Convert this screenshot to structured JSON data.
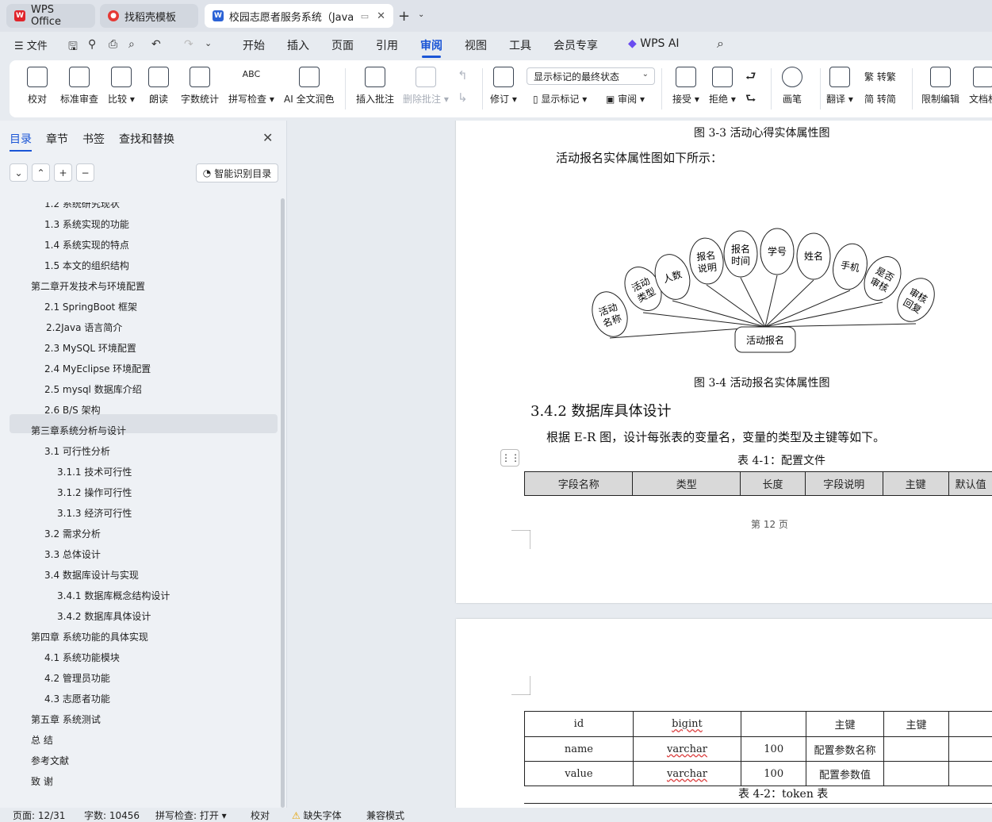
{
  "tabs": [
    {
      "label": "WPS Office",
      "icon": "wps-logo-icon",
      "color": "#e0242b"
    },
    {
      "label": "找稻壳模板",
      "icon": "docer-logo-icon",
      "color": "#e53935"
    },
    {
      "label": "校园志愿者服务系统（Java+s",
      "icon": "word-doc-icon",
      "color": "#2b62d6"
    }
  ],
  "menu": {
    "file": "文件",
    "items": [
      "开始",
      "插入",
      "页面",
      "引用",
      "审阅",
      "视图",
      "工具",
      "会员专享"
    ],
    "active": "审阅",
    "ai": "WPS AI"
  },
  "ribbon": {
    "buttons": [
      {
        "label": "校对"
      },
      {
        "label": "标准审查"
      },
      {
        "label": "比较 ▾"
      },
      {
        "label": "朗读"
      },
      {
        "label": "字数统计"
      },
      {
        "label": "拼写检查 ▾"
      },
      {
        "label": "AI 全文润色"
      },
      {
        "label": "插入批注"
      },
      {
        "label": "删除批注 ▾"
      },
      {
        "label": "修订 ▾"
      },
      {
        "label": "接受 ▾"
      },
      {
        "label": "拒绝 ▾"
      },
      {
        "label": "画笔"
      },
      {
        "label": "翻译 ▾"
      },
      {
        "label": "限制编辑"
      },
      {
        "label": "文档权"
      }
    ],
    "markup_select": "显示标记的最终状态",
    "show_markup": "显示标记 ▾",
    "review": "审阅 ▾",
    "to_traditional": "转繁",
    "to_simplified": "转简"
  },
  "sidebar": {
    "tabs": [
      "目录",
      "章节",
      "书签",
      "查找和替换"
    ],
    "ai_toc": "智能识别目录",
    "toc": [
      {
        "text": "1.2   系统研究现状"
      },
      {
        "text": "1.3   系统实现的功能"
      },
      {
        "text": "1.4 系统实现的特点"
      },
      {
        "text": "1.5   本文的组织结构"
      },
      {
        "text": "第二章开发技术与环境配置"
      },
      {
        "text": "2.1   SpringBoot 框架"
      },
      {
        "text": "2.2Java 语言简介"
      },
      {
        "text": "2.3   MySQL 环境配置"
      },
      {
        "text": "2.4   MyEclipse 环境配置"
      },
      {
        "text": "2.5   mysql 数据库介绍"
      },
      {
        "text": "2.6   B/S 架构"
      },
      {
        "text": "第三章系统分析与设计"
      },
      {
        "text": "3.1  可行性分析"
      },
      {
        "text": "3.1.1  技术可行性"
      },
      {
        "text": "3.1.2  操作可行性"
      },
      {
        "text": "3.1.3 经济可行性"
      },
      {
        "text": "3.2   需求分析"
      },
      {
        "text": "3.3   总体设计"
      },
      {
        "text": "3.4   数据库设计与实现"
      },
      {
        "text": "3.4.1    数据库概念结构设计"
      },
      {
        "text": "3.4.2 数据库具体设计"
      },
      {
        "text": "第四章   系统功能的具体实现"
      },
      {
        "text": "4.1  系统功能模块"
      },
      {
        "text": "4.2 管理员功能"
      },
      {
        "text": "4.3 志愿者功能"
      },
      {
        "text": "第五章  系统测试"
      },
      {
        "text": "总  结"
      },
      {
        "text": "参考文献"
      },
      {
        "text": "致  谢"
      }
    ]
  },
  "document": {
    "fig33_caption": "图 3-3 活动心得实体属性图",
    "intro_34": "活动报名实体属性图如下所示：",
    "er": {
      "entity": "活动报名",
      "attributes": [
        "活动名称",
        "活动类型",
        "人数",
        "报名说明",
        "报名时间",
        "学号",
        "姓名",
        "手机",
        "是否审核",
        "审核回复"
      ]
    },
    "fig34_caption": "图 3-4 活动报名实体属性图",
    "section": "3.4.2 数据库具体设计",
    "para": "根据 E-R 图，设计每张表的变量名，变量的类型及主键等如下。",
    "table41_caption": "表 4-1：配置文件",
    "table_headers": [
      "字段名称",
      "类型",
      "长度",
      "字段说明",
      "主键",
      "默认值"
    ],
    "page_number": "第  12  页",
    "table_rows": [
      [
        "id",
        "bigint",
        "",
        "主键",
        "主键",
        ""
      ],
      [
        "name",
        "varchar",
        "100",
        "配置参数名称",
        "",
        ""
      ],
      [
        "value",
        "varchar",
        "100",
        "配置参数值",
        "",
        ""
      ]
    ],
    "table42_caption": "表 4-2：token 表"
  },
  "status": {
    "page": "页面: 12/31",
    "words": "字数: 10456",
    "spell": "拼写检查: 打开 ▾",
    "proof": "校对",
    "missing_font": "缺失字体",
    "compat": "兼容模式"
  }
}
